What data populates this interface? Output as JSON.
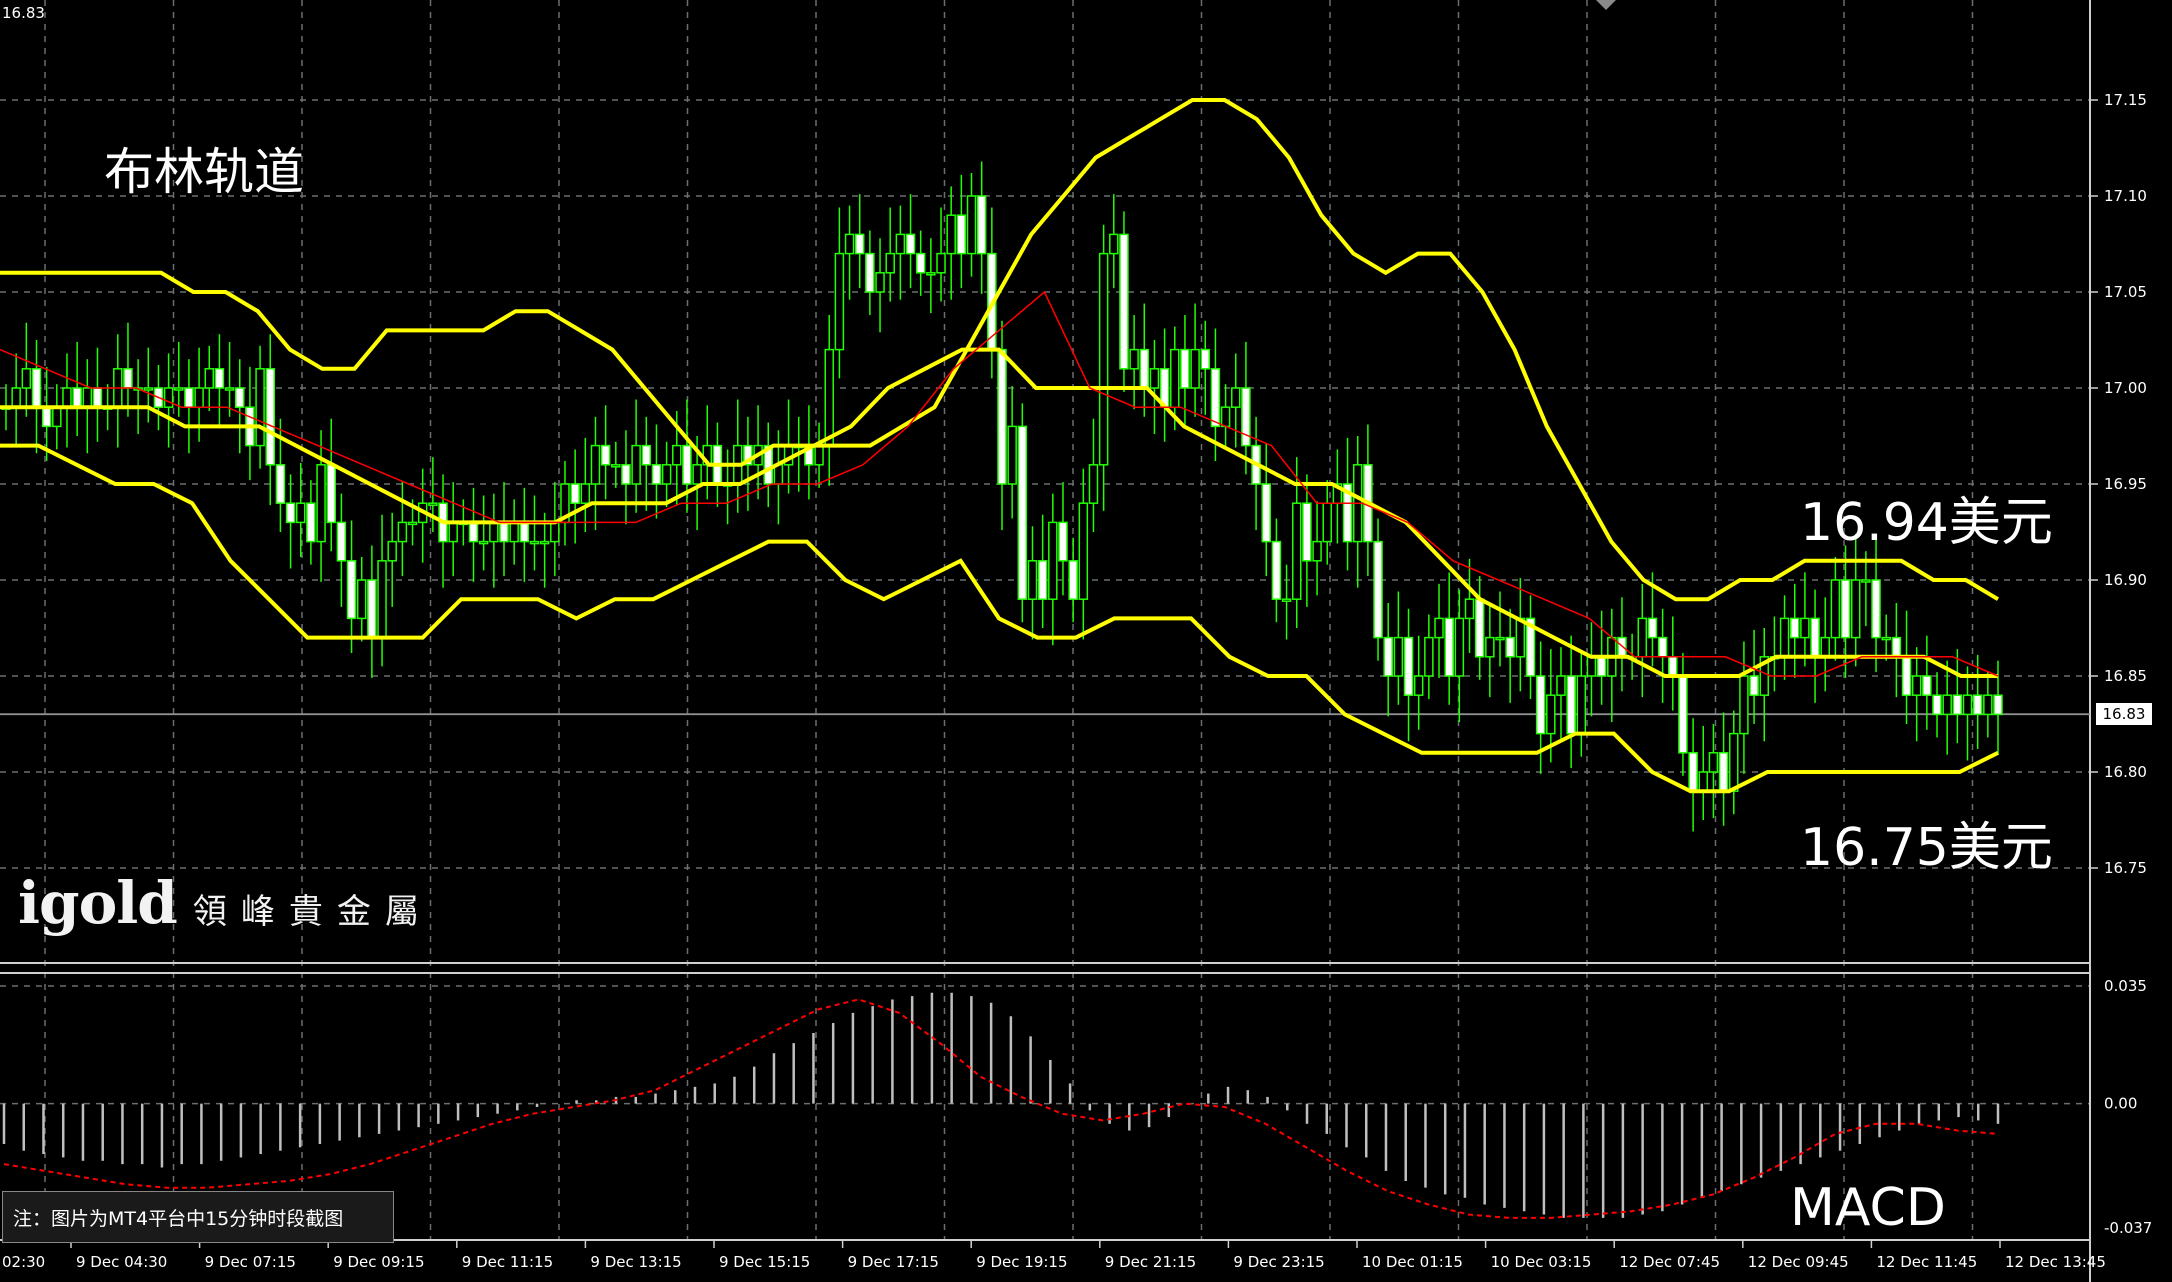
{
  "chart_title": "布林轨道",
  "upper_band_label": "16.94美元",
  "lower_band_label": "16.75美元",
  "macd_label": "MACD",
  "note": "注：图片为MT4平台中15分钟时段截图",
  "logo": {
    "main": "igold",
    "sub": "領峰貴金屬"
  },
  "top_left_price": "16.83",
  "current_price": "16.83",
  "colors": {
    "background": "#000000",
    "grid": "#6a6f6f",
    "candle": "#22ff00",
    "bollinger": "#ffff00",
    "ma": "#ff0000",
    "macd_bar": "#bfbfbf",
    "macd_signal": "#ff0000"
  },
  "chart_data": [
    {
      "type": "candlestick",
      "title": "布林轨道",
      "ylim": [
        16.72,
        17.2
      ],
      "y_ticks": [
        "17.15",
        "17.10",
        "17.05",
        "17.00",
        "16.95",
        "16.90",
        "16.85",
        "16.80",
        "16.75"
      ],
      "x_ticks": [
        "02:30",
        "9 Dec 04:30",
        "9 Dec 07:15",
        "9 Dec 09:15",
        "9 Dec 11:15",
        "9 Dec 13:15",
        "9 Dec 15:15",
        "9 Dec 17:15",
        "9 Dec 19:15",
        "9 Dec 21:15",
        "9 Dec 23:15",
        "10 Dec 01:15",
        "10 Dec 03:15",
        "12 Dec 07:45",
        "12 Dec 09:45",
        "12 Dec 11:45",
        "12 Dec 13:45"
      ],
      "close": [
        16.99,
        17.0,
        17.01,
        16.99,
        16.98,
        16.99,
        17.0,
        16.99,
        17.0,
        16.99,
        16.99,
        17.01,
        17.0,
        17.0,
        17.0,
        16.99,
        17.0,
        17.0,
        16.99,
        17.0,
        17.01,
        17.0,
        17.0,
        16.99,
        16.97,
        17.01,
        16.96,
        16.94,
        16.93,
        16.94,
        16.92,
        16.96,
        16.93,
        16.91,
        16.88,
        16.9,
        16.87,
        16.91,
        16.92,
        16.93,
        16.93,
        16.94,
        16.94,
        16.92,
        16.93,
        16.93,
        16.92,
        16.92,
        16.93,
        16.92,
        16.93,
        16.92,
        16.92,
        16.92,
        16.93,
        16.95,
        16.94,
        16.95,
        16.97,
        16.96,
        16.96,
        16.95,
        16.97,
        16.96,
        16.95,
        16.96,
        16.97,
        16.95,
        16.96,
        16.97,
        16.95,
        16.95,
        16.97,
        16.96,
        16.97,
        16.95,
        16.96,
        16.97,
        16.97,
        16.96,
        16.97,
        17.02,
        17.07,
        17.08,
        17.07,
        17.05,
        17.06,
        17.07,
        17.08,
        17.07,
        17.06,
        17.06,
        17.07,
        17.09,
        17.07,
        17.1,
        17.07,
        17.02,
        16.95,
        16.98,
        16.89,
        16.91,
        16.89,
        16.93,
        16.91,
        16.89,
        16.94,
        16.96,
        17.07,
        17.08,
        17.01,
        17.02,
        17.0,
        17.01,
        16.99,
        17.02,
        17.0,
        17.02,
        17.01,
        16.98,
        16.99,
        17.0,
        16.97,
        16.95,
        16.92,
        16.89,
        16.89,
        16.94,
        16.91,
        16.92,
        16.94,
        16.95,
        16.92,
        16.96,
        16.92,
        16.87,
        16.85,
        16.87,
        16.84,
        16.85,
        16.87,
        16.88,
        16.85,
        16.88,
        16.89,
        16.86,
        16.87,
        16.87,
        16.86,
        16.88,
        16.85,
        16.82,
        16.84,
        16.85,
        16.82,
        16.85,
        16.86,
        16.85,
        16.87,
        16.86,
        16.86,
        16.88,
        16.87,
        16.86,
        16.85,
        16.81,
        16.79,
        16.8,
        16.81,
        16.79,
        16.82,
        16.85,
        16.84,
        16.86,
        16.86,
        16.88,
        16.87,
        16.88,
        16.86,
        16.87,
        16.9,
        16.87,
        16.9,
        16.9,
        16.87,
        16.87,
        16.86,
        16.84,
        16.85,
        16.84,
        16.83,
        16.84,
        16.83,
        16.84,
        16.83,
        16.84,
        16.83
      ],
      "bollinger_upper": [
        17.06,
        17.06,
        17.06,
        17.06,
        17.06,
        17.06,
        17.05,
        17.05,
        17.04,
        17.02,
        17.01,
        17.01,
        17.03,
        17.03,
        17.03,
        17.03,
        17.04,
        17.04,
        17.03,
        17.02,
        17.0,
        16.98,
        16.96,
        16.96,
        16.97,
        16.97,
        16.97,
        16.97,
        16.98,
        16.99,
        17.02,
        17.05,
        17.08,
        17.1,
        17.12,
        17.13,
        17.14,
        17.15,
        17.15,
        17.14,
        17.12,
        17.09,
        17.07,
        17.06,
        17.07,
        17.07,
        17.05,
        17.02,
        16.98,
        16.95,
        16.92,
        16.9,
        16.89,
        16.89,
        16.9,
        16.9,
        16.91,
        16.91,
        16.91,
        16.91,
        16.9,
        16.9,
        16.89
      ],
      "bollinger_middle": [
        16.99,
        16.99,
        16.99,
        16.99,
        16.99,
        16.98,
        16.98,
        16.98,
        16.97,
        16.96,
        16.95,
        16.94,
        16.93,
        16.93,
        16.93,
        16.93,
        16.94,
        16.94,
        16.94,
        16.95,
        16.95,
        16.96,
        16.97,
        16.98,
        17.0,
        17.01,
        17.02,
        17.02,
        17.0,
        17.0,
        17.0,
        17.0,
        16.98,
        16.97,
        16.96,
        16.95,
        16.95,
        16.94,
        16.93,
        16.91,
        16.89,
        16.88,
        16.87,
        16.86,
        16.86,
        16.85,
        16.85,
        16.85,
        16.86,
        16.86,
        16.86,
        16.86,
        16.86,
        16.85,
        16.85
      ],
      "bollinger_lower": [
        16.97,
        16.97,
        16.96,
        16.95,
        16.95,
        16.94,
        16.91,
        16.89,
        16.87,
        16.87,
        16.87,
        16.87,
        16.89,
        16.89,
        16.89,
        16.88,
        16.89,
        16.89,
        16.9,
        16.91,
        16.92,
        16.92,
        16.9,
        16.89,
        16.9,
        16.91,
        16.88,
        16.87,
        16.87,
        16.88,
        16.88,
        16.88,
        16.86,
        16.85,
        16.85,
        16.83,
        16.82,
        16.81,
        16.81,
        16.81,
        16.81,
        16.82,
        16.82,
        16.8,
        16.79,
        16.79,
        16.8,
        16.8,
        16.8,
        16.8,
        16.8,
        16.8,
        16.81
      ],
      "ma": [
        17.02,
        17.01,
        17.0,
        17.0,
        16.99,
        16.99,
        16.98,
        16.97,
        16.96,
        16.95,
        16.94,
        16.93,
        16.93,
        16.93,
        16.93,
        16.94,
        16.94,
        16.95,
        16.95,
        16.96,
        16.98,
        17.01,
        17.03,
        17.05,
        17.0,
        16.99,
        16.99,
        16.98,
        16.97,
        16.94,
        16.94,
        16.93,
        16.91,
        16.9,
        16.89,
        16.88,
        16.86,
        16.86,
        16.86,
        16.85,
        16.85,
        16.86,
        16.86,
        16.86,
        16.85
      ]
    },
    {
      "type": "bar",
      "title": "MACD",
      "ylim": [
        -0.037,
        0.035
      ],
      "y_ticks": [
        "0.035",
        "0.00",
        "-0.037"
      ],
      "histogram": [
        -0.012,
        -0.014,
        -0.015,
        -0.016,
        -0.017,
        -0.017,
        -0.018,
        -0.018,
        -0.019,
        -0.018,
        -0.018,
        -0.017,
        -0.016,
        -0.015,
        -0.014,
        -0.013,
        -0.012,
        -0.011,
        -0.01,
        -0.009,
        -0.008,
        -0.007,
        -0.006,
        -0.005,
        -0.004,
        -0.003,
        -0.002,
        -0.001,
        0.0,
        0.001,
        0.001,
        0.002,
        0.002,
        0.003,
        0.004,
        0.005,
        0.006,
        0.008,
        0.011,
        0.015,
        0.018,
        0.021,
        0.024,
        0.027,
        0.029,
        0.031,
        0.032,
        0.033,
        0.033,
        0.032,
        0.03,
        0.026,
        0.02,
        0.013,
        0.006,
        -0.002,
        -0.006,
        -0.008,
        -0.007,
        -0.004,
        0.0,
        0.003,
        0.005,
        0.004,
        0.002,
        -0.002,
        -0.006,
        -0.009,
        -0.013,
        -0.016,
        -0.02,
        -0.023,
        -0.025,
        -0.027,
        -0.028,
        -0.03,
        -0.031,
        -0.032,
        -0.033,
        -0.034,
        -0.034,
        -0.034,
        -0.034,
        -0.033,
        -0.032,
        -0.03,
        -0.028,
        -0.026,
        -0.024,
        -0.022,
        -0.02,
        -0.018,
        -0.016,
        -0.014,
        -0.012,
        -0.01,
        -0.008,
        -0.006,
        -0.005,
        -0.004,
        -0.005,
        -0.006
      ],
      "signal": [
        -0.018,
        -0.02,
        -0.022,
        -0.024,
        -0.025,
        -0.025,
        -0.024,
        -0.023,
        -0.021,
        -0.018,
        -0.014,
        -0.01,
        -0.006,
        -0.003,
        -0.001,
        0.001,
        0.004,
        0.01,
        0.016,
        0.022,
        0.028,
        0.031,
        0.027,
        0.018,
        0.008,
        0.002,
        -0.003,
        -0.005,
        -0.003,
        0.0,
        -0.001,
        -0.006,
        -0.013,
        -0.02,
        -0.026,
        -0.03,
        -0.033,
        -0.034,
        -0.034,
        -0.033,
        -0.032,
        -0.03,
        -0.027,
        -0.022,
        -0.016,
        -0.009,
        -0.006,
        -0.006,
        -0.008,
        -0.009
      ]
    }
  ]
}
